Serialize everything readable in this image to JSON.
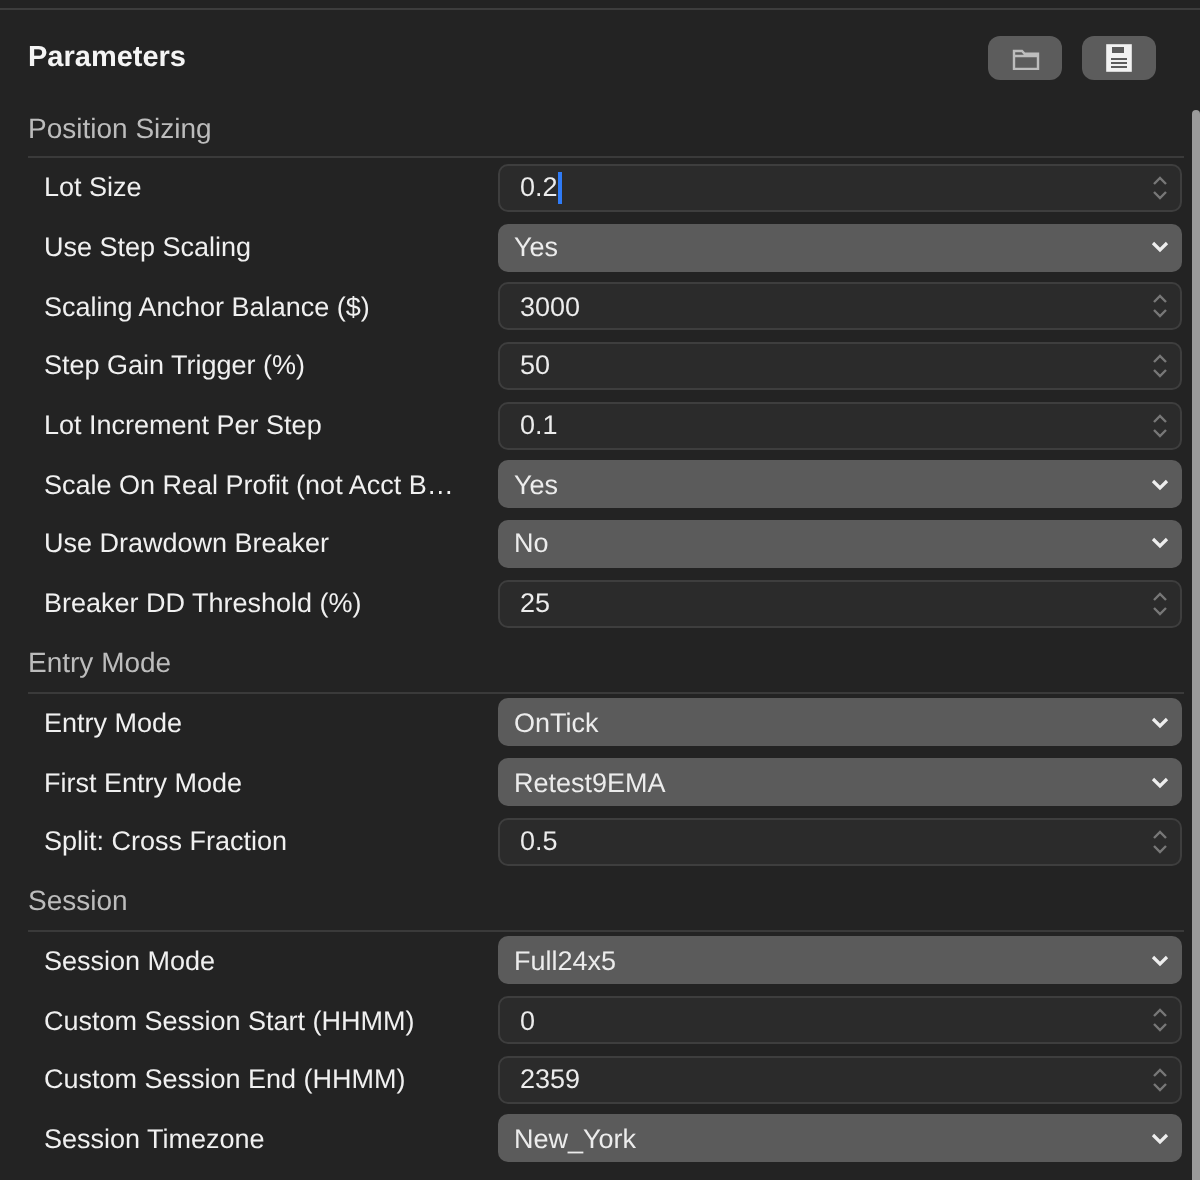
{
  "header": {
    "title": "Parameters"
  },
  "sections": [
    {
      "title": "Position Sizing",
      "rows": [
        {
          "label": "Lot Size",
          "kind": "number",
          "value": "0.2",
          "focused": true
        },
        {
          "label": "Use Step Scaling",
          "kind": "select",
          "value": "Yes",
          "focused": false
        },
        {
          "label": "Scaling Anchor Balance ($)",
          "kind": "number",
          "value": "3000",
          "focused": false
        },
        {
          "label": "Step Gain Trigger (%)",
          "kind": "number",
          "value": "50",
          "focused": false
        },
        {
          "label": "Lot Increment Per Step",
          "kind": "number",
          "value": "0.1",
          "focused": false
        },
        {
          "label": "Scale On Real Profit (not Acct B…",
          "kind": "select",
          "value": "Yes",
          "focused": false
        },
        {
          "label": "Use Drawdown Breaker",
          "kind": "select",
          "value": "No",
          "focused": false
        },
        {
          "label": "Breaker DD Threshold (%)",
          "kind": "number",
          "value": "25",
          "focused": false
        }
      ]
    },
    {
      "title": "Entry Mode",
      "rows": [
        {
          "label": "Entry Mode",
          "kind": "select",
          "value": "OnTick",
          "focused": false
        },
        {
          "label": "First Entry Mode",
          "kind": "select",
          "value": "Retest9EMA",
          "focused": false
        },
        {
          "label": "Split: Cross Fraction",
          "kind": "number",
          "value": "0.5",
          "focused": false
        }
      ]
    },
    {
      "title": "Session",
      "rows": [
        {
          "label": "Session Mode",
          "kind": "select",
          "value": "Full24x5",
          "focused": false
        },
        {
          "label": "Custom Session Start (HHMM)",
          "kind": "number",
          "value": "0",
          "focused": false
        },
        {
          "label": "Custom Session End (HHMM)",
          "kind": "number",
          "value": "2359",
          "focused": false
        },
        {
          "label": "Session Timezone",
          "kind": "select",
          "value": "New_York",
          "focused": false
        }
      ]
    }
  ]
}
